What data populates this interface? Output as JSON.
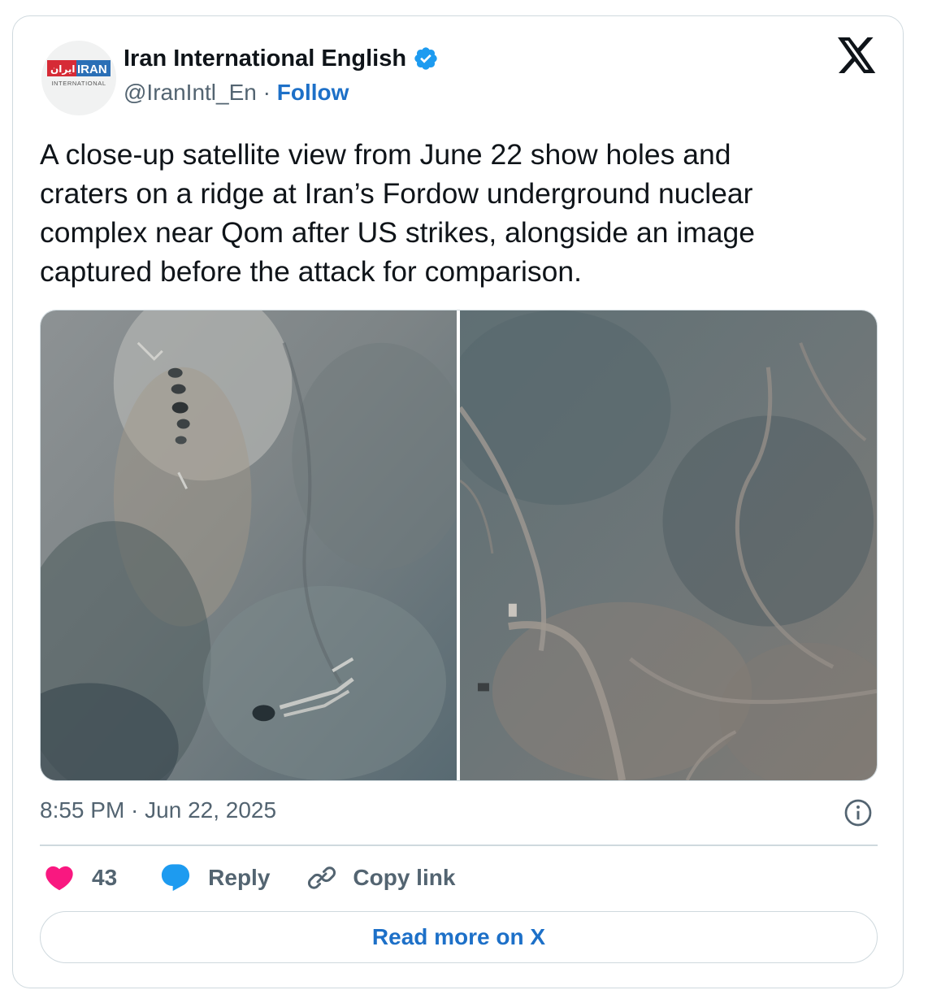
{
  "author": {
    "name": "Iran International English",
    "handle": "@IranIntl_En",
    "separator": "·",
    "follow_label": "Follow",
    "verified": true,
    "avatar_logo_text": "ایران IRAN",
    "avatar_logo_subtext": "INTERNATIONAL"
  },
  "tweet": {
    "text": "A close-up satellite view from June 22 show holes and\ncraters on a ridge at Iran’s Fordow underground nuclear\ncomplex near Qom after US strikes, alongside an image\ncaptured before the attack for comparison.",
    "timestamp": "8:55 PM · Jun 22, 2025"
  },
  "media": {
    "left_image": "satellite-after-strike",
    "right_image": "satellite-before-strike"
  },
  "actions": {
    "like_count": "43",
    "reply_label": "Reply",
    "copy_label": "Copy link"
  },
  "footer": {
    "read_more_label": "Read more on X"
  },
  "colors": {
    "link": "#1d70c8",
    "secondary_text": "#536471",
    "border": "#cfd9de",
    "like": "#f91880",
    "reply": "#1d9bf0",
    "verified": "#1d9bf0",
    "logo_red": "#d62b36",
    "logo_blue": "#2a6fb6"
  },
  "icons": {
    "platform": "x-logo-icon",
    "verified": "verified-badge-icon",
    "info": "info-icon",
    "like": "heart-icon",
    "reply": "speech-bubble-icon",
    "copy": "link-icon"
  }
}
